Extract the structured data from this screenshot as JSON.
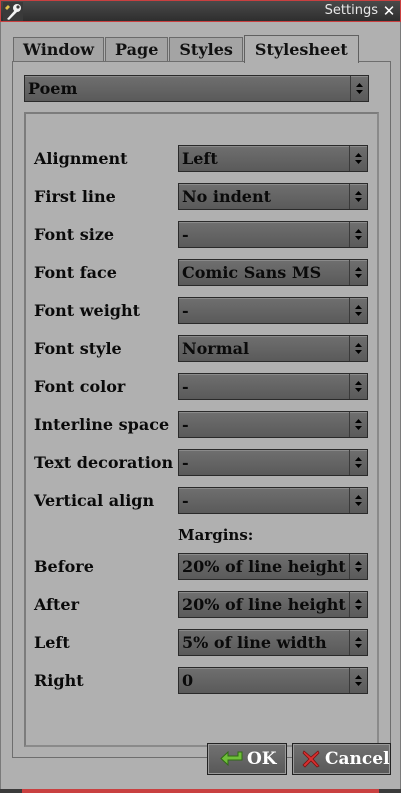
{
  "window": {
    "title": "Settings",
    "close_glyph": "✕"
  },
  "tabs": [
    {
      "label": "Window",
      "active": false
    },
    {
      "label": "Page",
      "active": false
    },
    {
      "label": "Styles",
      "active": false
    },
    {
      "label": "Stylesheet",
      "active": true
    }
  ],
  "style_select": {
    "value": "Poem"
  },
  "fields": [
    {
      "label": "Alignment",
      "value": "Left"
    },
    {
      "label": "First line",
      "value": "No indent"
    },
    {
      "label": "Font size",
      "value": "-"
    },
    {
      "label": "Font face",
      "value": "Comic Sans MS"
    },
    {
      "label": "Font weight",
      "value": "-"
    },
    {
      "label": "Font style",
      "value": "Normal"
    },
    {
      "label": "Font color",
      "value": "-"
    },
    {
      "label": "Interline space",
      "value": "-"
    },
    {
      "label": "Text decoration",
      "value": "-"
    },
    {
      "label": "Vertical align",
      "value": "-"
    }
  ],
  "margins": {
    "heading": "Margins:",
    "fields": [
      {
        "label": "Before",
        "value": "20% of line height"
      },
      {
        "label": "After",
        "value": "20% of line height"
      },
      {
        "label": "Left",
        "value": "5% of line width"
      },
      {
        "label": "Right",
        "value": "0"
      }
    ]
  },
  "buttons": {
    "ok": "OK",
    "cancel": "Cancel"
  },
  "colors": {
    "ok_icon": "#6fbf3a",
    "cancel_icon": "#d83030",
    "accent_border": "#c94040"
  }
}
